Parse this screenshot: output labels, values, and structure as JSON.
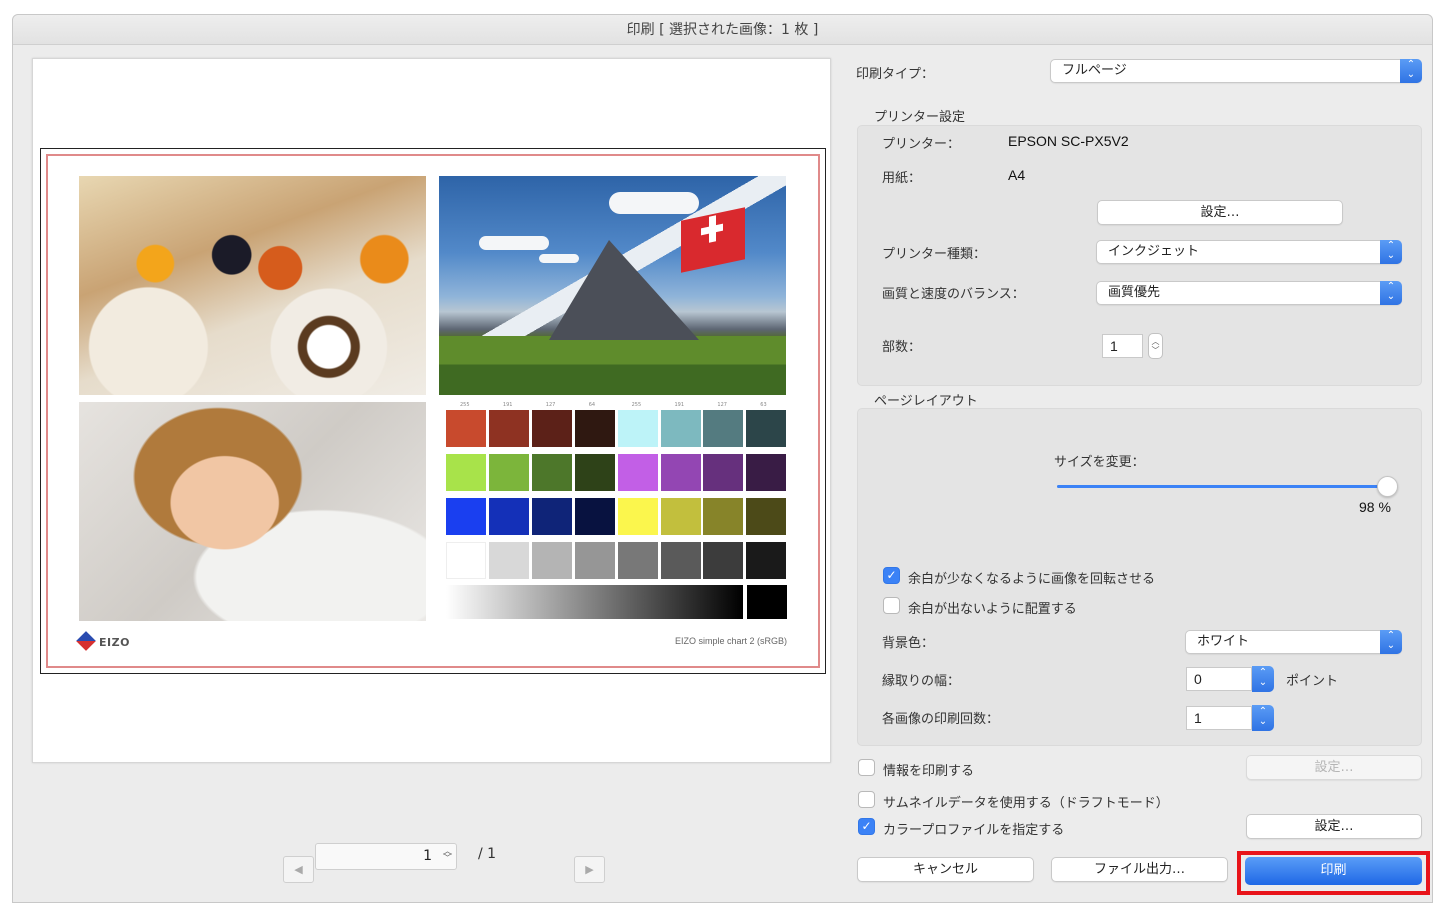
{
  "window": {
    "title": "印刷 [ 選択された画像：1 枚 ]"
  },
  "preview": {
    "logo_text": "EIZO",
    "chart_caption": "EIZO simple chart 2 (sRGB)",
    "scale_top": [
      "255",
      "191",
      "127",
      "64",
      "255",
      "191",
      "127",
      "63"
    ],
    "swatch_rows": [
      [
        "#c84a2d",
        "#8e3222",
        "#5c2118",
        "#2f1811",
        "#bdf3f8",
        "#7db9bf",
        "#547b80",
        "#2c4549"
      ],
      [
        "#a8e34a",
        "#7cb53b",
        "#4d772a",
        "#2e4218",
        "#c25fe6",
        "#9346b3",
        "#66307d",
        "#391c45"
      ],
      [
        "#1a3ff0",
        "#1430b8",
        "#0f2478",
        "#081240",
        "#fbf64d",
        "#c2bf3d",
        "#878429",
        "#4c4a18"
      ],
      [
        "#ffffff",
        "#d8d8d8",
        "#b4b4b4",
        "#969696",
        "#787878",
        "#5a5a5a",
        "#3c3c3c",
        "#1a1a1a"
      ]
    ]
  },
  "pager": {
    "current": "1",
    "total": "/ 1",
    "prev_icon": "◀",
    "next_icon": "▶"
  },
  "print_type": {
    "label": "印刷タイプ：",
    "value": "フルページ"
  },
  "printer_settings": {
    "section": "プリンター設定",
    "printer_label": "プリンター：",
    "printer_value": "EPSON SC-PX5V2",
    "paper_label": "用紙：",
    "paper_value": "A4",
    "settings_button": "設定…",
    "printer_type_label": "プリンター種類：",
    "printer_type_value": "インクジェット",
    "quality_label": "画質と速度のバランス：",
    "quality_value": "画質優先",
    "copies_label": "部数：",
    "copies_value": "1"
  },
  "page_layout": {
    "section": "ページレイアウト",
    "resize_label": "サイズを変更：",
    "resize_value": "98 %",
    "resize_fraction": 0.98,
    "rotate_label": "余白が少なくなるように画像を回転させる",
    "rotate_checked": true,
    "nomargin_label": "余白が出ないように配置する",
    "nomargin_checked": false,
    "background_label": "背景色：",
    "background_value": "ホワイト",
    "border_label": "縁取りの幅：",
    "border_value": "0",
    "border_unit": "ポイント",
    "repeat_label": "各画像の印刷回数：",
    "repeat_value": "1"
  },
  "options": {
    "print_info_label": "情報を印刷する",
    "print_info_checked": false,
    "print_info_button": "設定…",
    "thumbnail_label": "サムネイルデータを使用する（ドラフトモード）",
    "thumbnail_checked": false,
    "color_profile_label": "カラープロファイルを指定する",
    "color_profile_checked": true,
    "color_profile_button": "設定…"
  },
  "actions": {
    "cancel": "キャンセル",
    "export": "ファイル出力…",
    "print": "印刷"
  },
  "colors": {
    "accent": "#3b82f6",
    "highlight": "#e8141a",
    "page_border": "#e08a8a"
  }
}
